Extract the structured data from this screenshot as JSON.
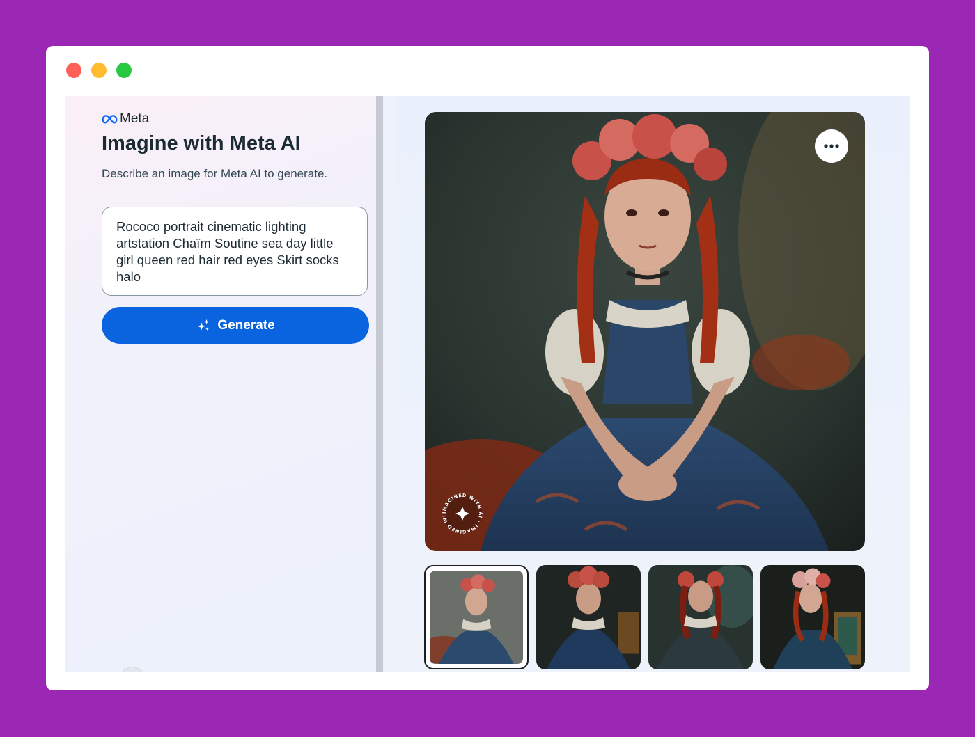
{
  "brand": {
    "name": "Meta",
    "logo_icon": "meta-infinity-icon",
    "logo_color": "#0866ff"
  },
  "header": {
    "title": "Imagine with Meta AI",
    "subtitle": "Describe an image for Meta AI to generate."
  },
  "prompt": {
    "value": "Rococo portrait cinematic lighting artstation Chaïm Soutine sea day little girl queen red hair red eyes Skirt socks halo"
  },
  "generate_button": {
    "label": "Generate",
    "icon": "sparkle-icon",
    "color": "#0a64e0"
  },
  "main_image": {
    "alt": "Generated painting of a red-haired girl in a blue rococo dress",
    "more_button_icon": "more-horizontal-icon",
    "watermark_text": "IMAGINED WITH AI · IMAGINED WITH AI ·"
  },
  "thumbnails": [
    {
      "alt": "Variation 1",
      "selected": true
    },
    {
      "alt": "Variation 2",
      "selected": false
    },
    {
      "alt": "Variation 3",
      "selected": false
    },
    {
      "alt": "Variation 4",
      "selected": false
    }
  ],
  "window_controls": [
    "close",
    "minimize",
    "zoom"
  ]
}
